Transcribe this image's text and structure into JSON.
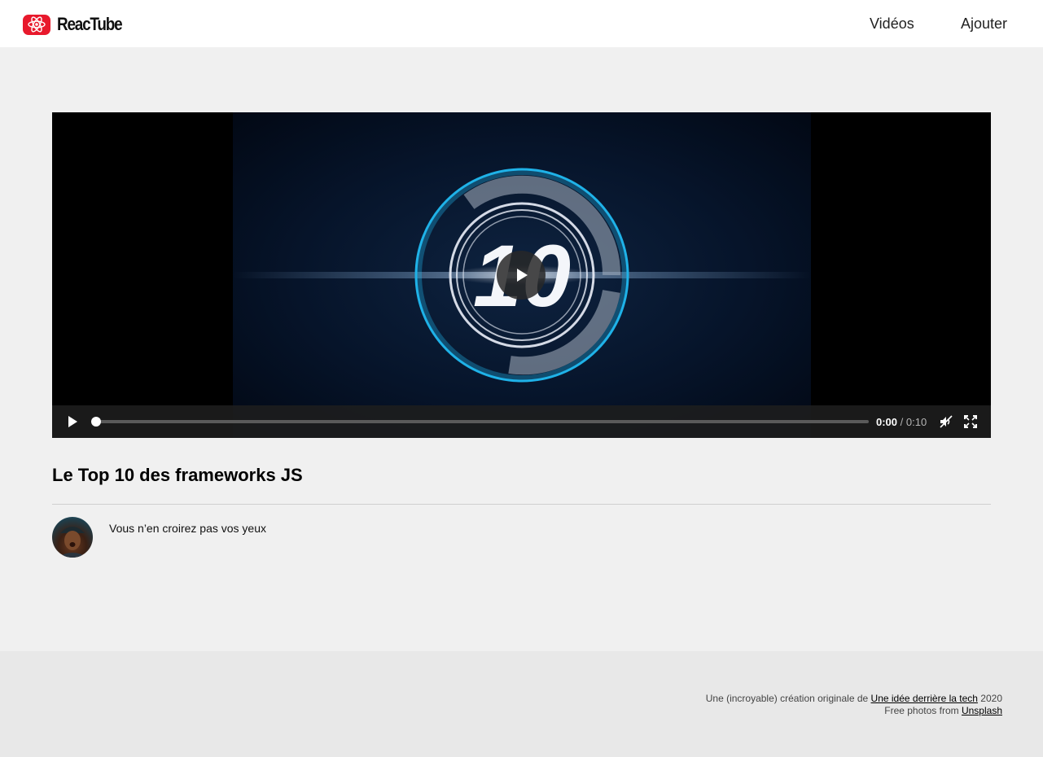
{
  "app": {
    "brand": "ReacTube",
    "accent": "#e8192c"
  },
  "nav": {
    "items": [
      {
        "label": "Vidéos"
      },
      {
        "label": "Ajouter"
      }
    ]
  },
  "player": {
    "current_time": "0:00",
    "separator": "/",
    "duration": "0:10",
    "progress": 0,
    "poster_text": "10",
    "icons": {
      "play": "play-icon",
      "mute": "muted-speaker-icon",
      "fullscreen": "fullscreen-icon"
    }
  },
  "video": {
    "title": "Le Top 10 des frameworks JS",
    "description": "Vous n’en croirez pas vos yeux"
  },
  "footer": {
    "line1": {
      "prefix": "Une (incroyable) création originale de",
      "link": "Une idée derrière la tech",
      "suffix": "2020"
    },
    "line2": {
      "prefix": "Free photos from",
      "link": "Unsplash"
    }
  }
}
